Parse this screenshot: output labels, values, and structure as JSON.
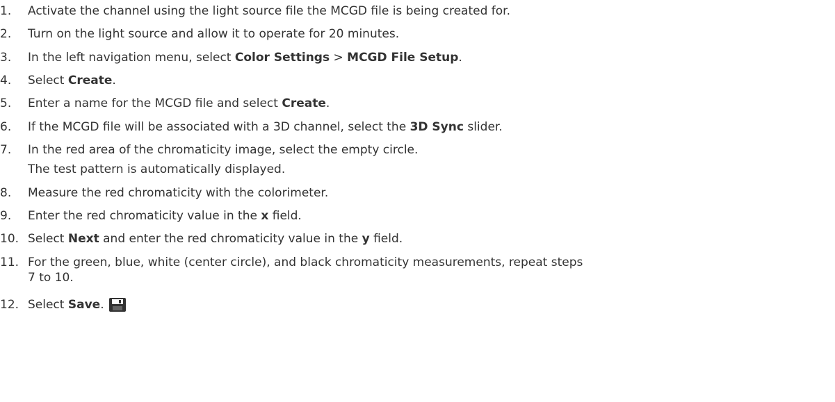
{
  "steps": [
    {
      "num": "1.",
      "parts": [
        "Activate the channel using the light source file the MCGD file is being created for."
      ]
    },
    {
      "num": "2.",
      "parts": [
        "Turn on the light source and allow it to operate for 20 minutes."
      ]
    },
    {
      "num": "3.",
      "parts": [
        "In the left navigation menu, select ",
        "Color Settings",
        " > ",
        "MCGD File Setup",
        "."
      ]
    },
    {
      "num": "4.",
      "parts": [
        "Select ",
        "Create",
        "."
      ]
    },
    {
      "num": "5.",
      "parts": [
        "Enter a name for the MCGD file and select ",
        "Create",
        "."
      ]
    },
    {
      "num": "6.",
      "parts": [
        "If the MCGD file will be associated with a 3D channel, select the ",
        "3D Sync",
        " slider."
      ]
    },
    {
      "num": "7.",
      "parts": [
        "In the red area of the chromaticity image, select the empty circle."
      ],
      "note": "The test pattern is automatically displayed."
    },
    {
      "num": "8.",
      "parts": [
        "Measure the red chromaticity with the colorimeter."
      ]
    },
    {
      "num": "9.",
      "parts": [
        "Enter the red chromaticity value in the ",
        "x",
        " field."
      ]
    },
    {
      "num": "10.",
      "parts": [
        "Select ",
        "Next",
        " and enter the red chromaticity value in the ",
        "y",
        " field."
      ]
    },
    {
      "num": "11.",
      "parts": [
        "For the green, blue, white (center circle), and black chromaticity measurements, repeat steps"
      ],
      "continuation": "7 to 10."
    },
    {
      "num": "12.",
      "parts": [
        "Select ",
        "Save",
        "."
      ],
      "icon": "save-icon"
    }
  ]
}
